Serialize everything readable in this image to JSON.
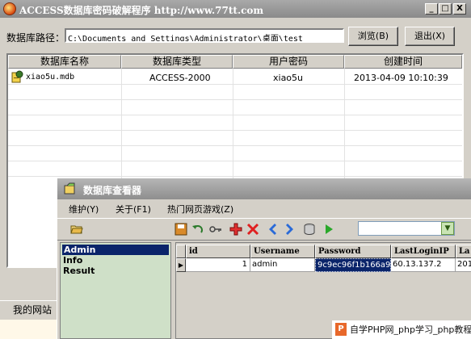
{
  "main_window": {
    "title": "ACCESS数据库密码破解程序 http://www.77tt.com",
    "controls": {
      "minimize": "_",
      "maximize": "□",
      "close": "X"
    },
    "path_label": "数据库路径：",
    "path_value": "C:\\Documents and Settings\\Administrator\\桌面\\test",
    "browse_button": "浏览(B)",
    "exit_button": "退出(X)",
    "list": {
      "columns": [
        "数据库名称",
        "数据库类型",
        "用户密码",
        "创建时间"
      ],
      "rows": [
        {
          "name": "xiao5u.mdb",
          "type": "ACCESS-2000",
          "password": "xiao5u",
          "created": "2013-04-09 10:10:39"
        }
      ]
    },
    "bottom_tab": "我的网站"
  },
  "viewer_window": {
    "title": "数据库查看器",
    "menus": [
      "维护(Y)",
      "关于(F1)",
      "热门网页游戏(Z)"
    ],
    "toolbar_icons": [
      "open-folder-icon",
      "save-icon",
      "undo-icon",
      "key-icon",
      "add-icon",
      "delete-icon",
      "prev-icon",
      "next-icon",
      "database-icon",
      "run-icon"
    ],
    "tables": [
      "Admin",
      "Info",
      "Result"
    ],
    "grid": {
      "columns": [
        "id",
        "Username",
        "Password",
        "LastLoginIP",
        "La"
      ],
      "rows": [
        {
          "id": "1",
          "username": "admin",
          "password": "9c9ec96f1b166a9",
          "ip": "60.13.137.2",
          "last": "201"
        }
      ]
    }
  },
  "watermark": {
    "logo": "P",
    "text": "自学PHP网_php学习_php教程"
  }
}
